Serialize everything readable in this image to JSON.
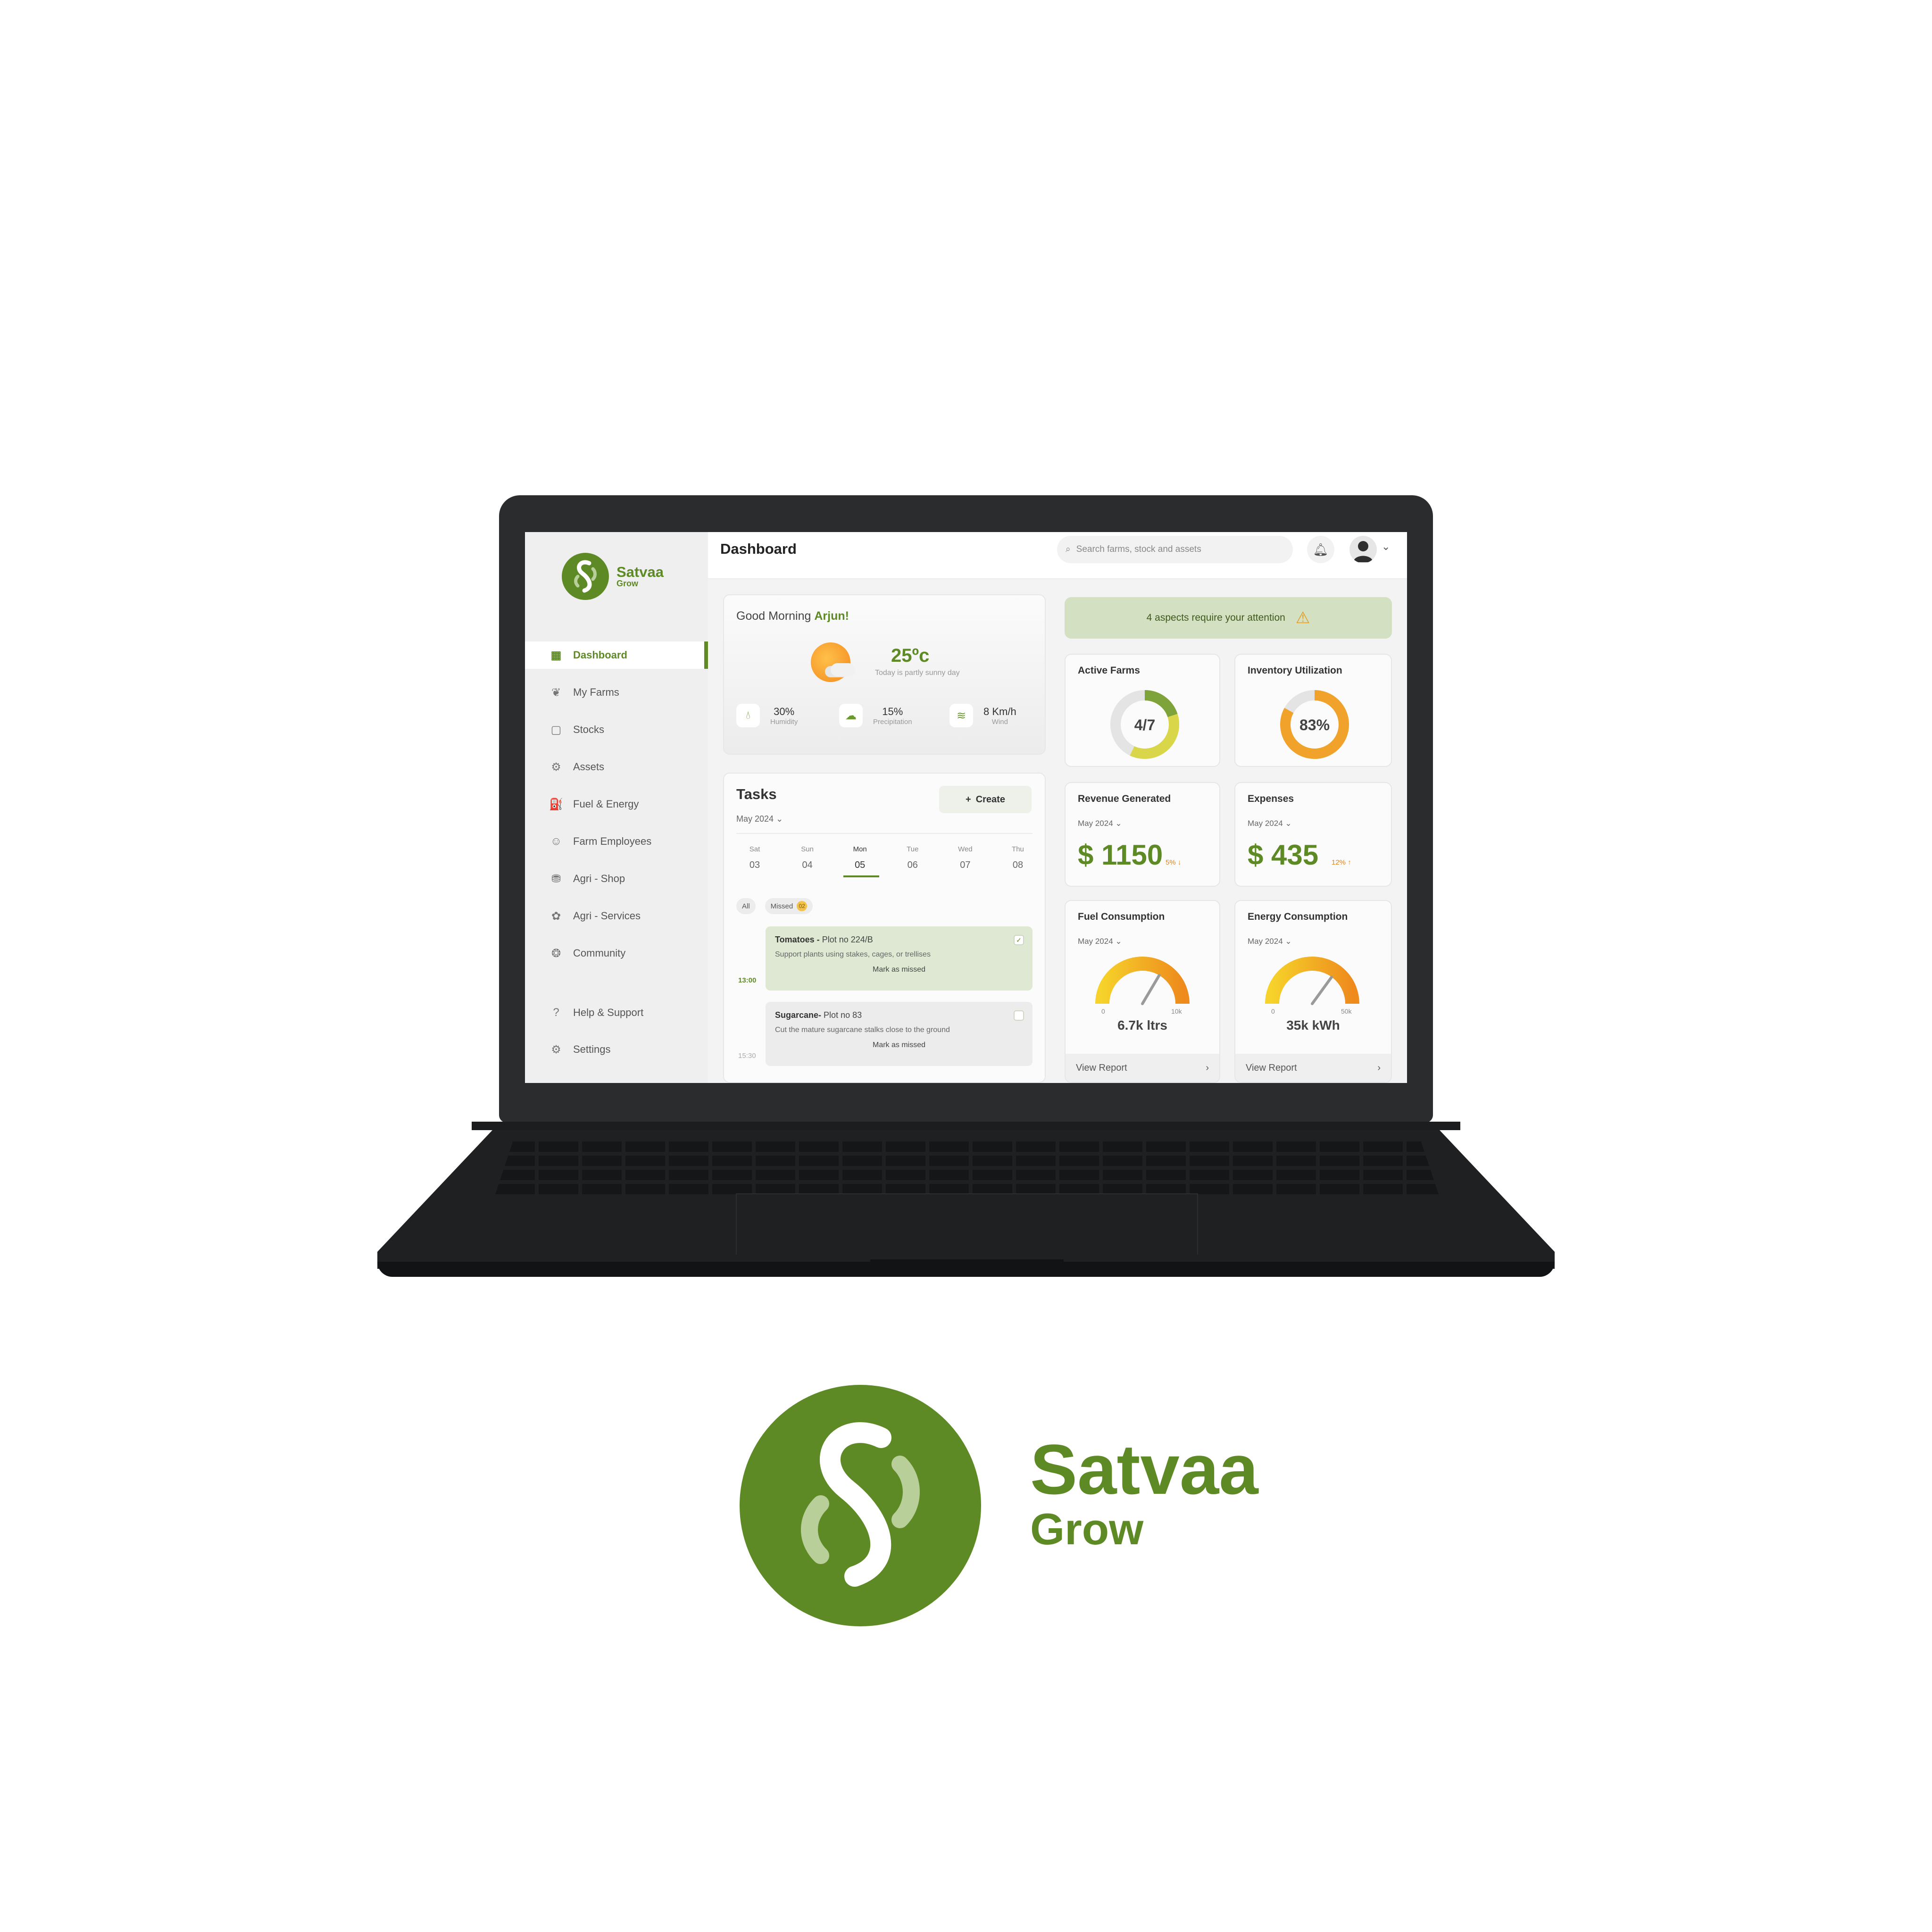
{
  "brand": {
    "name": "Satvaa",
    "sub": "Grow"
  },
  "header": {
    "title": "Dashboard",
    "search_placeholder": "Search farms, stock and assets"
  },
  "sidebar": {
    "items": [
      {
        "label": "Dashboard",
        "icon": "grid-icon"
      },
      {
        "label": "My Farms",
        "icon": "leaf-icon"
      },
      {
        "label": "Stocks",
        "icon": "box-icon"
      },
      {
        "label": "Assets",
        "icon": "tractor-icon"
      },
      {
        "label": "Fuel & Energy",
        "icon": "fuel-icon"
      },
      {
        "label": "Farm Employees",
        "icon": "people-icon"
      },
      {
        "label": "Agri - Shop",
        "icon": "bag-icon"
      },
      {
        "label": "Agri - Services",
        "icon": "services-icon"
      },
      {
        "label": "Community",
        "icon": "community-icon"
      }
    ],
    "bottom": [
      {
        "label": "Help & Support",
        "icon": "help-icon"
      },
      {
        "label": "Settings",
        "icon": "settings-icon"
      }
    ]
  },
  "greeting": {
    "prefix": "Good Morning ",
    "name": "Arjun!"
  },
  "weather": {
    "temp": "25ºc",
    "note": "Today is partly sunny day",
    "humidity": {
      "value": "30%",
      "label": "Humidity"
    },
    "precipitation": {
      "value": "15%",
      "label": "Precipitation"
    },
    "wind": {
      "value": "8 Km/h",
      "label": "Wind"
    }
  },
  "tasks": {
    "title": "Tasks",
    "create_label": "Create",
    "month": "May 2024",
    "days": [
      {
        "name": "Sat",
        "date": "03"
      },
      {
        "name": "Sun",
        "date": "04"
      },
      {
        "name": "Mon",
        "date": "05"
      },
      {
        "name": "Tue",
        "date": "06"
      },
      {
        "name": "Wed",
        "date": "07"
      },
      {
        "name": "Thu",
        "date": "08"
      }
    ],
    "filters": {
      "all": "All",
      "missed": "Missed",
      "missed_count": "02"
    },
    "items": [
      {
        "time": "13:00",
        "crop": "Tomatoes - ",
        "plot": "Plot no 224/B",
        "desc": "Support plants using stakes, cages, or trellises",
        "action": "Mark as missed"
      },
      {
        "time": "15:30",
        "crop": "Sugarcane- ",
        "plot": "Plot no 83",
        "desc": "Cut the mature sugarcane stalks close to the ground",
        "action": "Mark as missed"
      }
    ]
  },
  "alert": {
    "text": "4 aspects require your attention"
  },
  "stats": {
    "active_farms": {
      "title": "Active Farms",
      "value": "4/7",
      "fraction": 0.571
    },
    "inventory": {
      "title": "Inventory Utilization",
      "value": "83%",
      "fraction": 0.83
    },
    "revenue": {
      "title": "Revenue Generated",
      "month": "May 2024",
      "value": "$ 1150",
      "trend": "5% ↓"
    },
    "expenses": {
      "title": "Expenses",
      "month": "May 2024",
      "value": "$ 435",
      "trend": "12% ↑"
    },
    "fuel": {
      "title": "Fuel Consumption",
      "month": "May 2024",
      "min": "0",
      "max": "10k",
      "value": "6.7k ltrs",
      "fraction": 0.67,
      "report": "View Report"
    },
    "energy": {
      "title": "Energy Consumption",
      "month": "May 2024",
      "min": "0",
      "max": "50k",
      "value": "35k kWh",
      "fraction": 0.7,
      "report": "View Report"
    }
  },
  "colors": {
    "brand": "#5e8a25",
    "accent": "#f2a22a",
    "alert_bg": "#d4e0c2"
  }
}
